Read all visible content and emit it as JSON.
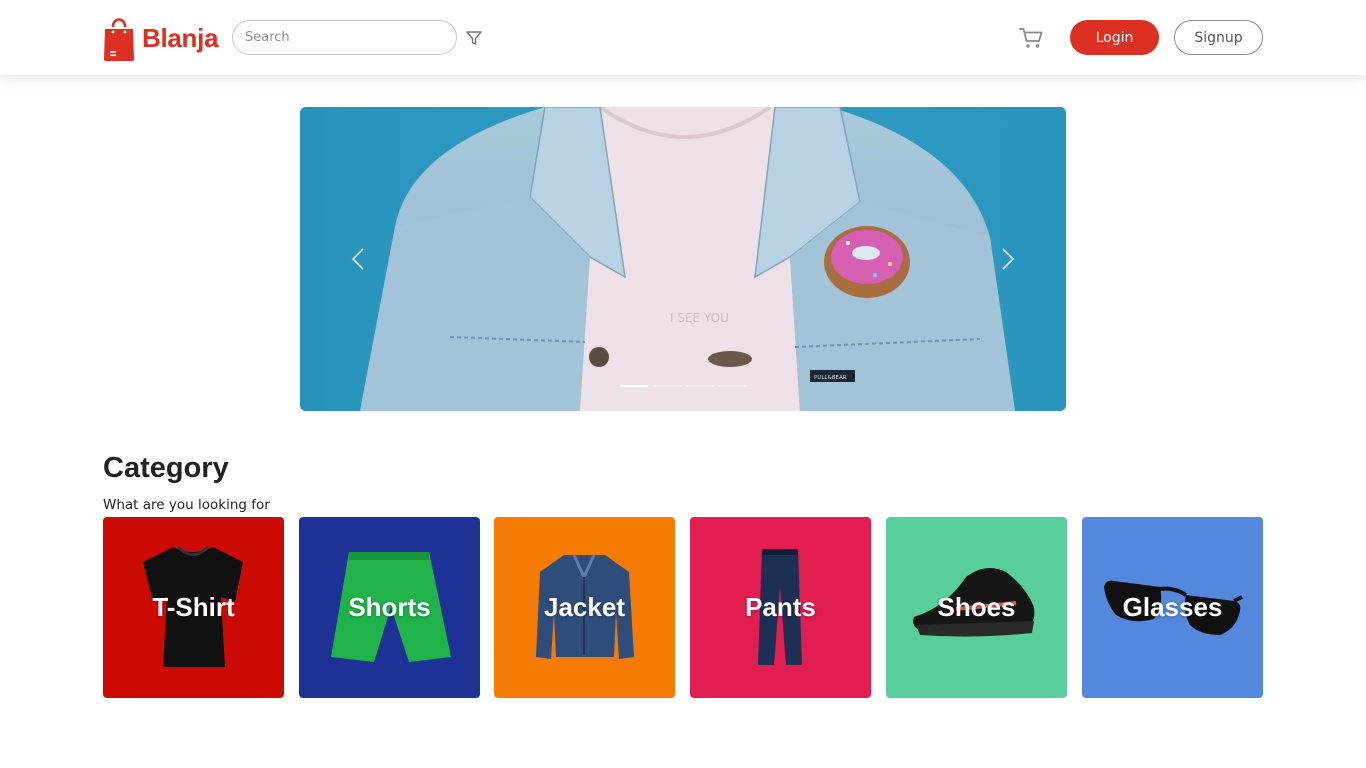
{
  "header": {
    "brand": "Blanja",
    "search_placeholder": "Search",
    "login_label": "Login",
    "signup_label": "Signup",
    "icons": {
      "filter": "filter-icon",
      "cart": "cart-icon"
    },
    "accent_color": "#db3022"
  },
  "carousel": {
    "slide_count": 4,
    "active_index": 0,
    "shirt_text": "I SEE YOU",
    "tag_text": "PULL&BEAR"
  },
  "category": {
    "title": "Category",
    "subtitle": "What are you looking for",
    "items": [
      {
        "label": "T-Shirt",
        "color": "#cc0b04"
      },
      {
        "label": "Shorts",
        "color": "#1e3296"
      },
      {
        "label": "Jacket",
        "color": "#f57b04"
      },
      {
        "label": "Pants",
        "color": "#e21d50"
      },
      {
        "label": "Shoes",
        "color": "#57ce9c"
      },
      {
        "label": "Glasses",
        "color": "#5388dc"
      }
    ]
  }
}
